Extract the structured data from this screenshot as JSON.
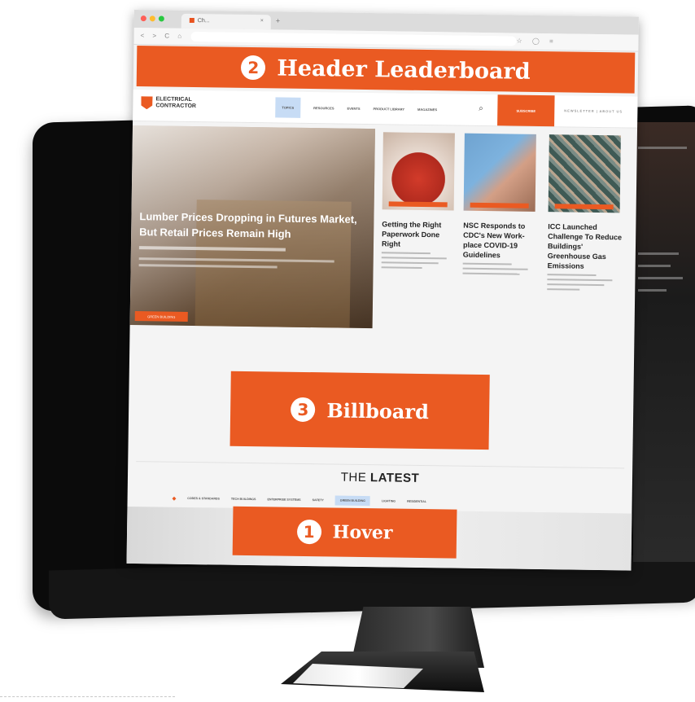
{
  "browser": {
    "tab_label": "Ch...",
    "nav_buttons": "< > C ⌂",
    "tool_icons": "☆ ◯ ≡",
    "traffic_lights": [
      "#ff5f57",
      "#febc2e",
      "#28c840"
    ]
  },
  "placements": {
    "header_leaderboard": {
      "number": "2",
      "label": "Header Leaderboard"
    },
    "billboard": {
      "number": "3",
      "label": "Billboard"
    },
    "hover": {
      "number": "1",
      "label": "Hover"
    }
  },
  "site": {
    "logo_line1": "ELECTRICAL",
    "logo_line2": "CONTRACTOR",
    "nav": [
      "TOPICS",
      "RESOURCES",
      "EVENTS",
      "PRODUCT LIBRARY",
      "MAGAZINES"
    ],
    "subscribe": "SUBSCRIBE",
    "right_links": "NEWSLETTER | ABOUT US"
  },
  "hero": {
    "title": "Lumber Prices Dropping in Futures Market, But Retail Prices Remain High",
    "badge": "GREEN BUILDING"
  },
  "cards": [
    {
      "title": "Getting the Right Paperwork Done Right"
    },
    {
      "title": "NSC Responds to CDC's New Work-place COVID-19 Guidelines"
    },
    {
      "title": "ICC Launched Challenge To Reduce Buildings' Greenhouse Gas Emissions"
    }
  ],
  "latest": {
    "prefix": "THE",
    "bold": "LATEST",
    "categories": [
      "CODES & STANDARDS",
      "TECH BUILDINGS",
      "ENTERPRISE SYSTEMS",
      "SAFETY",
      "GREEN BUILDING",
      "LIGHTING",
      "RESIDENTIAL"
    ],
    "active_category": "GREEN BUILDING"
  },
  "colors": {
    "accent": "#ea5a22",
    "nav_highlight": "#c7dcf5"
  }
}
